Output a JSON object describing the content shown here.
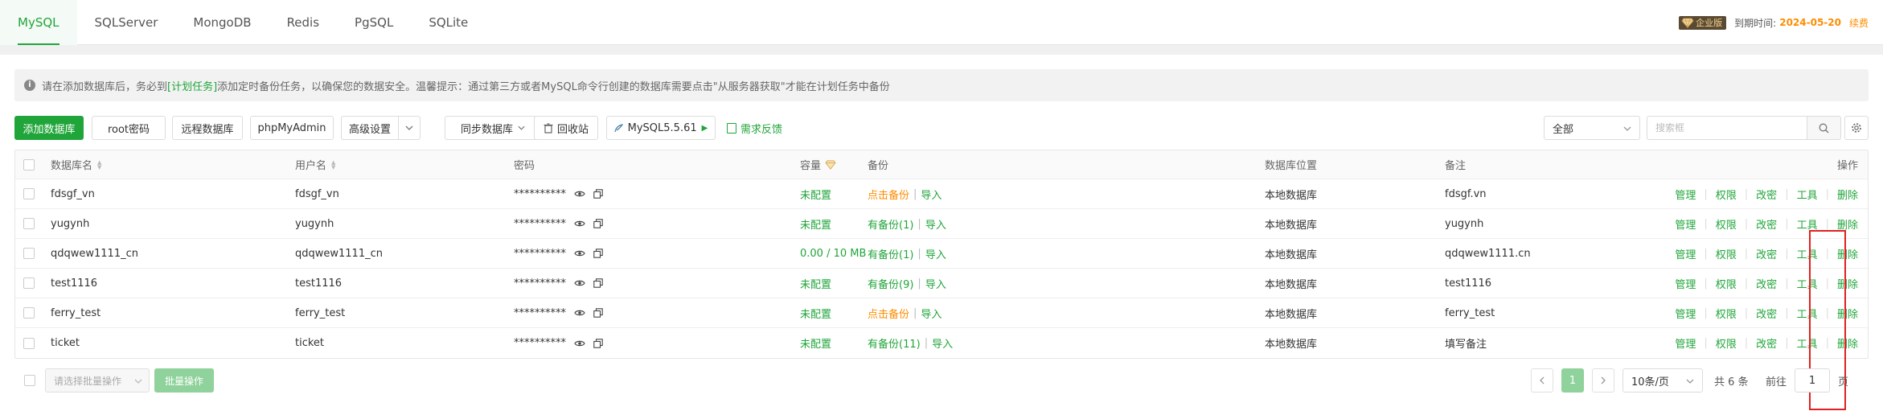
{
  "tabs": [
    "MySQL",
    "SQLServer",
    "MongoDB",
    "Redis",
    "PgSQL",
    "SQLite"
  ],
  "active_tab": "MySQL",
  "header": {
    "edition_badge": "企业版",
    "expire_label": "到期时间:",
    "expire_date": "2024-05-20",
    "renew": "续费"
  },
  "notice": {
    "prefix": "请在添加数据库后，务必到",
    "link": "[计划任务]",
    "suffix": "添加定时备份任务，以确保您的数据安全。温馨提示：通过第三方或者MySQL命令行创建的数据库需要点击\"从服务器获取\"才能在计划任务中备份"
  },
  "toolbar": {
    "add_db": "添加数据库",
    "root_pwd": "root密码",
    "remote_db": "远程数据库",
    "phpmyadmin": "phpMyAdmin",
    "advanced": "高级设置",
    "sync_db": "同步数据库",
    "recycle": "回收站",
    "mysql_version": "MySQL5.5.61",
    "feedback": "需求反馈",
    "filter_value": "全部",
    "search_placeholder": "搜索框"
  },
  "table": {
    "headers": {
      "name": "数据库名",
      "user": "用户名",
      "password": "密码",
      "capacity": "容量",
      "backup": "备份",
      "location": "数据库位置",
      "remark": "备注",
      "ops": "操作"
    },
    "ops": [
      "管理",
      "权限",
      "改密",
      "工具",
      "删除"
    ],
    "rows": [
      {
        "name": "fdsgf_vn",
        "user": "fdsgf_vn",
        "password": "**********",
        "capacity": "未配置",
        "backup": "点击备份",
        "backup_ok": false,
        "import": "导入",
        "location": "本地数据库",
        "remark": "fdsgf.vn"
      },
      {
        "name": "yugynh",
        "user": "yugynh",
        "password": "**********",
        "capacity": "未配置",
        "backup": "有备份(1)",
        "backup_ok": true,
        "import": "导入",
        "location": "本地数据库",
        "remark": "yugynh"
      },
      {
        "name": "qdqwew1111_cn",
        "user": "qdqwew1111_cn",
        "password": "**********",
        "capacity": "0.00 / 10 MB",
        "backup": "有备份(1)",
        "backup_ok": true,
        "import": "导入",
        "location": "本地数据库",
        "remark": "qdqwew1111.cn"
      },
      {
        "name": "test1116",
        "user": "test1116",
        "password": "**********",
        "capacity": "未配置",
        "backup": "有备份(9)",
        "backup_ok": true,
        "import": "导入",
        "location": "本地数据库",
        "remark": "test1116"
      },
      {
        "name": "ferry_test",
        "user": "ferry_test",
        "password": "**********",
        "capacity": "未配置",
        "backup": "点击备份",
        "backup_ok": false,
        "import": "导入",
        "location": "本地数据库",
        "remark": "ferry_test"
      },
      {
        "name": "ticket",
        "user": "ticket",
        "password": "**********",
        "capacity": "未配置",
        "backup": "有备份(11)",
        "backup_ok": true,
        "import": "导入",
        "location": "本地数据库",
        "remark": "填写备注"
      }
    ]
  },
  "footer": {
    "batch_placeholder": "请选择批量操作",
    "batch_button": "批量操作",
    "current_page": "1",
    "page_size": "10条/页",
    "total": "共 6 条",
    "goto_label": "前往",
    "goto_value": "1",
    "page_suffix": "页"
  },
  "colors": {
    "accent": "#20a53a",
    "warning": "#ff8c00",
    "highlight_box": "#e02020"
  }
}
